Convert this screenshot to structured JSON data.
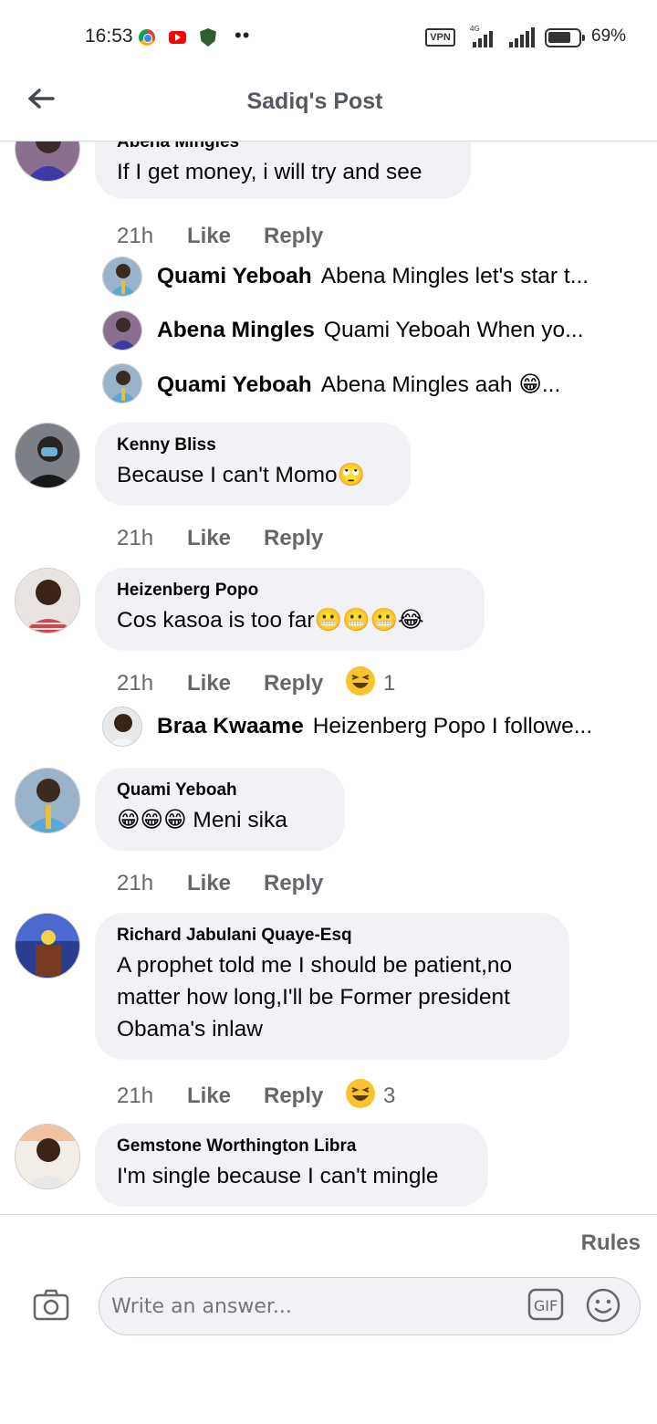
{
  "status_bar": {
    "time": "16:53",
    "vpn": "VPN",
    "network": "4G",
    "battery": "69%"
  },
  "header": {
    "title": "Sadiq's Post"
  },
  "comments": [
    {
      "author": "Abena Mingles",
      "text": "If I get money, i will try and see",
      "time": "21h",
      "like": "Like",
      "reply": "Reply",
      "replies": [
        {
          "author": "Quami Yeboah",
          "text": "Abena Mingles let's star t..."
        },
        {
          "author": "Abena Mingles",
          "text": "Quami Yeboah  When yo..."
        },
        {
          "author": "Quami Yeboah",
          "text": "Abena Mingles aah 😁..."
        }
      ]
    },
    {
      "author": "Kenny Bliss",
      "text": "Because I can't Momo🙄",
      "time": "21h",
      "like": "Like",
      "reply": "Reply"
    },
    {
      "author": "Heizenberg Popo",
      "text": "Cos kasoa is too far😬😬😬😂",
      "time": "21h",
      "like": "Like",
      "reply": "Reply",
      "reaction_count": "1",
      "replies": [
        {
          "author": "Braa Kwaame",
          "text": "Heizenberg Popo I followe..."
        }
      ]
    },
    {
      "author": "Quami Yeboah",
      "text": "😁😁😁 Meni sika",
      "time": "21h",
      "like": "Like",
      "reply": "Reply"
    },
    {
      "author": "Richard Jabulani Quaye-Esq",
      "text": "A prophet told me I should be patient,no matter how long,I'll be Former president Obama's inlaw",
      "time": "21h",
      "like": "Like",
      "reply": "Reply",
      "reaction_count": "3"
    },
    {
      "author": "Gemstone Worthington Libra",
      "text": "I'm single because I can't mingle"
    }
  ],
  "composer": {
    "rules": "Rules",
    "placeholder": "Write an answer...",
    "icons": [
      "camera-icon",
      "gif-icon",
      "smile-icon"
    ]
  },
  "colors": {
    "bubble": "#f0f2f5",
    "secondary_text": "#65676b",
    "title": "#555a60"
  }
}
